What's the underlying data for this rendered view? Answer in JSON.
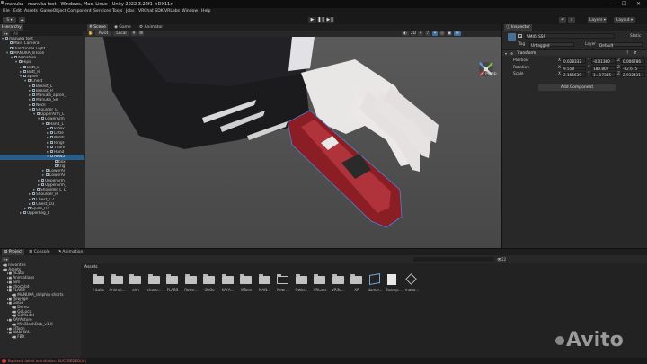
{
  "window": {
    "title": "manuka - manuka test - Windows, Mac, Linux - Unity 2022.3.22f1 <DX11>",
    "min": "—",
    "max": "☐",
    "close": "✕"
  },
  "menu": [
    "File",
    "Edit",
    "Assets",
    "GameObject",
    "Component",
    "Services",
    "Tools",
    "Jobs",
    "VRChat SDK",
    "VRLabs",
    "Window",
    "Help"
  ],
  "toolbar": {
    "account": "S ▾",
    "layers": "Layers",
    "layout": "Layout",
    "play": "▶",
    "pause": "❚❚",
    "step": "▶❚"
  },
  "hierarchy": {
    "tab": "Hierarchy",
    "search_placeholder": "All",
    "rows": [
      {
        "text": "manuka test",
        "depth": 0,
        "arrow": "▾",
        "sel": false
      },
      {
        "text": "Main Camera",
        "depth": 1,
        "arrow": "",
        "sel": false
      },
      {
        "text": "Directional Light",
        "depth": 1,
        "arrow": "",
        "sel": false
      },
      {
        "text": "MANUKA_lilToon",
        "depth": 1,
        "arrow": "▾",
        "sel": false
      },
      {
        "text": "Armature",
        "depth": 2,
        "arrow": "▾",
        "sel": false
      },
      {
        "text": "Hips",
        "depth": 3,
        "arrow": "▾",
        "sel": false
      },
      {
        "text": "Butt_L",
        "depth": 4,
        "arrow": "▸",
        "sel": false
      },
      {
        "text": "Butt_R",
        "depth": 4,
        "arrow": "▸",
        "sel": false
      },
      {
        "text": "Spine",
        "depth": 4,
        "arrow": "▾",
        "sel": false
      },
      {
        "text": "Chest",
        "depth": 5,
        "arrow": "▾",
        "sel": false
      },
      {
        "text": "Breast_L",
        "depth": 6,
        "arrow": "▸",
        "sel": false
      },
      {
        "text": "Breast_R",
        "depth": 6,
        "arrow": "▸",
        "sel": false
      },
      {
        "text": "Manuka_apron_",
        "depth": 6,
        "arrow": "▸",
        "sel": false
      },
      {
        "text": "Manuka_Se",
        "depth": 6,
        "arrow": "▸",
        "sel": false
      },
      {
        "text": "Neck",
        "depth": 6,
        "arrow": "▸",
        "sel": false
      },
      {
        "text": "Shoulder_L",
        "depth": 6,
        "arrow": "▾",
        "sel": false
      },
      {
        "text": "UpperArm_L",
        "depth": 7,
        "arrow": "▾",
        "sel": false
      },
      {
        "text": "LowerArm_",
        "depth": 8,
        "arrow": "▾",
        "sel": false
      },
      {
        "text": "Hand_L",
        "depth": 9,
        "arrow": "▾",
        "sel": false
      },
      {
        "text": "Index",
        "depth": 10,
        "arrow": "▸",
        "sel": false
      },
      {
        "text": "Little",
        "depth": 10,
        "arrow": "▸",
        "sel": false
      },
      {
        "text": "Middl",
        "depth": 10,
        "arrow": "▸",
        "sel": false
      },
      {
        "text": "RingF",
        "depth": 10,
        "arrow": "▸",
        "sel": false
      },
      {
        "text": "Thum",
        "depth": 10,
        "arrow": "▸",
        "sel": false
      },
      {
        "text": "Hand",
        "depth": 10,
        "arrow": "▸",
        "sel": false
      },
      {
        "text": "AM45",
        "depth": 10,
        "arrow": "▾",
        "sel": true
      },
      {
        "text": "box",
        "depth": 11,
        "arrow": "",
        "sel": false
      },
      {
        "text": "trig",
        "depth": 11,
        "arrow": "",
        "sel": false
      },
      {
        "text": "LowerAr",
        "depth": 9,
        "arrow": "▸",
        "sel": false
      },
      {
        "text": "LowerAr",
        "depth": 9,
        "arrow": "▸",
        "sel": false
      },
      {
        "text": "UpperArm_",
        "depth": 8,
        "arrow": "▸",
        "sel": false
      },
      {
        "text": "UpperArm_",
        "depth": 8,
        "arrow": "▸",
        "sel": false
      },
      {
        "text": "Shoulder_L_D",
        "depth": 7,
        "arrow": "▸",
        "sel": false
      },
      {
        "text": "Shoulder_R",
        "depth": 6,
        "arrow": "▸",
        "sel": false
      },
      {
        "text": "Chest_C2",
        "depth": 6,
        "arrow": "▸",
        "sel": false
      },
      {
        "text": "Chest_D1",
        "depth": 6,
        "arrow": "▸",
        "sel": false
      },
      {
        "text": "Spine_D1",
        "depth": 5,
        "arrow": "▸",
        "sel": false
      },
      {
        "text": "UpperLeg_L",
        "depth": 4,
        "arrow": "▸",
        "sel": false
      }
    ]
  },
  "scene": {
    "tabs": [
      "Scene",
      "Game",
      "Animator"
    ],
    "pivot": "Pivot",
    "local": "Local",
    "persp": "< Persp"
  },
  "inspector": {
    "tab": "Inspector",
    "name": "AM45 SSP",
    "static": "Static",
    "tag_label": "Tag",
    "tag": "Untagged",
    "layer_label": "Layer",
    "layer": "Default",
    "component": "Transform",
    "rows": [
      {
        "label": "Position",
        "x": "0.028332",
        "y": "-0.01360",
        "z": "0.006786"
      },
      {
        "label": "Rotation",
        "x": "9.558",
        "y": "180.802",
        "z": "-82.675"
      },
      {
        "label": "Scale",
        "x": "2.155639",
        "y": "1.417345",
        "z": "2.932431"
      }
    ],
    "add_component": "Add Component"
  },
  "project": {
    "tabs": [
      "Project",
      "Console",
      "Animation"
    ],
    "tree": [
      {
        "text": "Favorites",
        "depth": 0
      },
      {
        "text": "Assets",
        "depth": 0
      },
      {
        "text": "!iLabs",
        "depth": 1
      },
      {
        "text": "Animations",
        "depth": 1
      },
      {
        "text": "aim",
        "depth": 1
      },
      {
        "text": "chocolat",
        "depth": 1
      },
      {
        "text": "FLABS",
        "depth": 1
      },
      {
        "text": "MANUKA_dolphin shorts",
        "depth": 2
      },
      {
        "text": "flow-lge",
        "depth": 1
      },
      {
        "text": "GoGo",
        "depth": 1
      },
      {
        "text": "Demo",
        "depth": 2
      },
      {
        "text": "GoLoco",
        "depth": 2
      },
      {
        "text": "GoModel",
        "depth": 2
      },
      {
        "text": "KAYAstore",
        "depth": 1
      },
      {
        "text": "MiniDashBob_v1.0",
        "depth": 2
      },
      {
        "text": "lilToon",
        "depth": 1
      },
      {
        "text": "MANUKA",
        "depth": 1
      },
      {
        "text": "FBX",
        "depth": 2
      }
    ],
    "breadcrumb": "Assets",
    "search_count": "22",
    "assets": [
      {
        "label": "!iLabs",
        "kind": "folder"
      },
      {
        "label": "Animat...",
        "kind": "folder"
      },
      {
        "label": "aim",
        "kind": "folder"
      },
      {
        "label": "choco...",
        "kind": "folder"
      },
      {
        "label": "FLABS",
        "kind": "folder"
      },
      {
        "label": "flowe...",
        "kind": "folder"
      },
      {
        "label": "GoGo",
        "kind": "folder"
      },
      {
        "label": "KAYA...",
        "kind": "folder"
      },
      {
        "label": "lilToon",
        "kind": "folder"
      },
      {
        "label": "MAN...",
        "kind": "folder"
      },
      {
        "label": "New ...",
        "kind": "folder-open"
      },
      {
        "label": "Owlu...",
        "kind": "folder"
      },
      {
        "label": "VRLabs",
        "kind": "folder"
      },
      {
        "label": "VRSu...",
        "kind": "folder"
      },
      {
        "label": "XR",
        "kind": "folder"
      },
      {
        "label": "dance...",
        "kind": "package"
      },
      {
        "label": "Examp...",
        "kind": "doc"
      },
      {
        "label": "manu...",
        "kind": "unity"
      }
    ]
  },
  "status": {
    "text": "Backend failed to initialize: SUCCEEDED(hr)",
    "watermark": "Avito"
  },
  "colors": {
    "accent": "#2c5d87",
    "error": "#d33b3b",
    "weapon": "#8b1e24"
  }
}
